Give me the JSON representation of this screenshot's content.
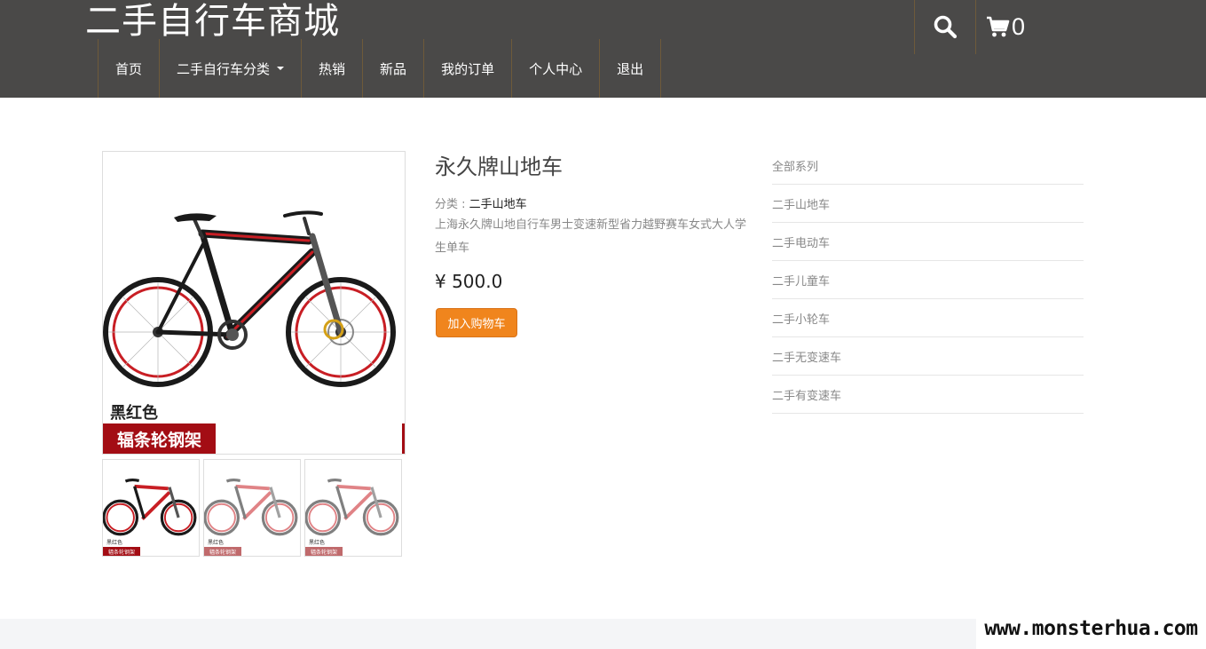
{
  "header": {
    "site_title": "二手自行车商城",
    "nav": [
      {
        "label": "首页"
      },
      {
        "label": "二手自行车分类"
      },
      {
        "label": "热销"
      },
      {
        "label": "新品"
      },
      {
        "label": "我的订单"
      },
      {
        "label": "个人中心"
      },
      {
        "label": "退出"
      }
    ],
    "search_icon": "search-icon",
    "cart_icon": "cart-icon",
    "cart_count": "0"
  },
  "product": {
    "name": "永久牌山地车",
    "category_prefix": "分类 : ",
    "category": "二手山地车",
    "description": "上海永久牌山地自行车男士变速新型省力越野赛车女式大人学生单车",
    "price": "¥ 500.0",
    "add_to_cart": "加入购物车",
    "image_color_text": "黑红色",
    "image_spoke_text": "辐条轮钢架"
  },
  "sidebar": {
    "items": [
      {
        "label": "全部系列"
      },
      {
        "label": "二手山地车"
      },
      {
        "label": "二手电动车"
      },
      {
        "label": "二手儿童车"
      },
      {
        "label": "二手小轮车"
      },
      {
        "label": "二手无变速车"
      },
      {
        "label": "二手有变速车"
      }
    ]
  },
  "watermark": "www.monsterhua.com",
  "colors": {
    "header_bg": "#4a4948",
    "accent_orange": "#f0851d",
    "bike_red": "#a30d14"
  }
}
